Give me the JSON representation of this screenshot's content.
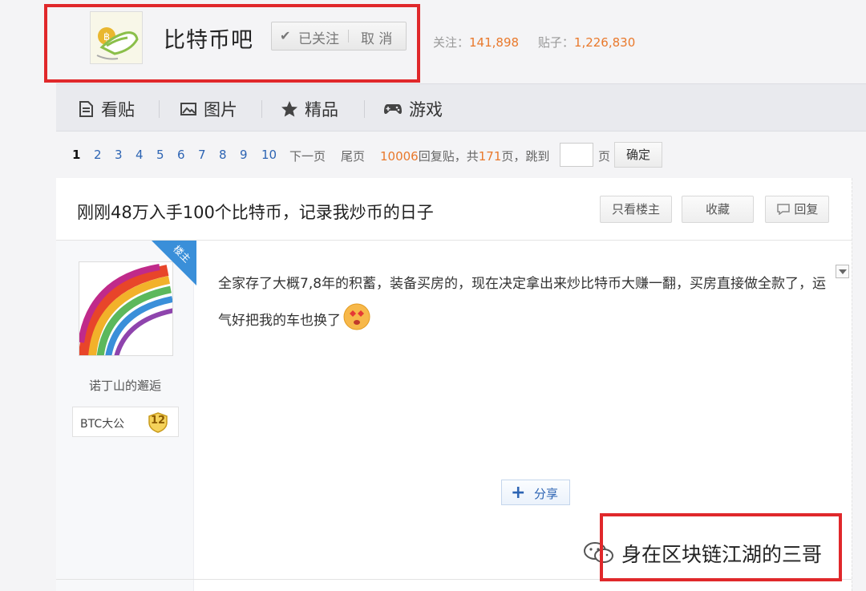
{
  "header": {
    "forum_title": "比特币吧",
    "follow_status": "已关注",
    "cancel_label": "取 消",
    "followers_label": "关注：",
    "followers_count": "141,898",
    "posts_label": "贴子：",
    "posts_count": "1,226,830"
  },
  "nav": {
    "items": [
      {
        "label": "看贴",
        "icon": "document-icon"
      },
      {
        "label": "图片",
        "icon": "image-icon"
      },
      {
        "label": "精品",
        "icon": "star-icon"
      },
      {
        "label": "游戏",
        "icon": "gamepad-icon"
      }
    ]
  },
  "pager": {
    "current": "1",
    "pages": [
      "2",
      "3",
      "4",
      "5",
      "6",
      "7",
      "8",
      "9",
      "10"
    ],
    "next_label": "下一页",
    "last_label": "尾页",
    "reply_count": "10006",
    "reply_label": "回复贴，共",
    "total_pages": "171",
    "total_label": "页，跳到",
    "page_unit": "页",
    "confirm_label": "确定"
  },
  "thread": {
    "title": "刚刚48万入手100个比特币，记录我炒币的日子",
    "only_op_label": "只看楼主",
    "favorite_label": "收藏",
    "reply_label": "回复"
  },
  "post": {
    "op_tag": "楼主",
    "username": "诺丁山的邂逅",
    "badge_name": "BTC大公",
    "badge_level": "12",
    "content": "全家存了大概7,8年的积蓄，装备买房的，现在决定拿出来炒比特币大赚一翻，买房直接做全款了，运气好把我的车也换了",
    "share_label": "分享"
  },
  "watermark": {
    "text": "身在区块链江湖的三哥"
  },
  "colors": {
    "accent_blue": "#2d64b3",
    "accent_orange": "#e9792c",
    "highlight_red": "#e0282b",
    "op_tag_blue": "#3a8fd9"
  }
}
